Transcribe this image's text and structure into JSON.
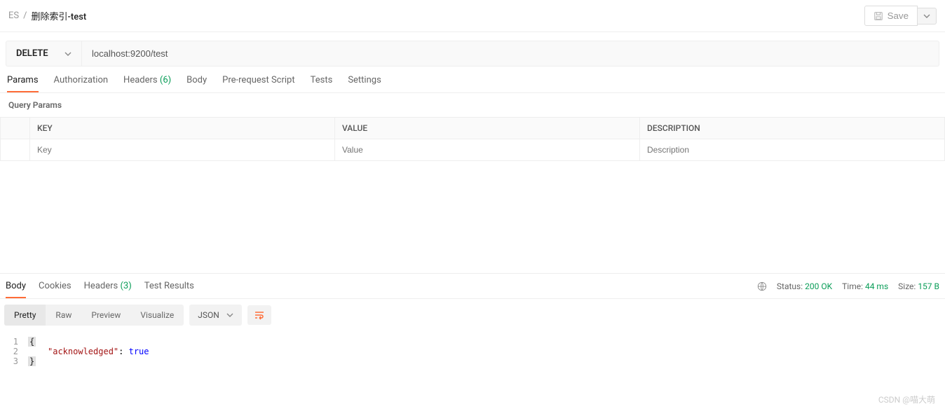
{
  "breadcrumb": {
    "workspace": "ES",
    "separator": "/",
    "title": "删除索引-test"
  },
  "header": {
    "save_label": "Save"
  },
  "request": {
    "method": "DELETE",
    "url": "localhost:9200/test"
  },
  "tabs": {
    "params": "Params",
    "authorization": "Authorization",
    "headers": "Headers",
    "headers_count": "(6)",
    "body": "Body",
    "prerequest": "Pre-request Script",
    "tests": "Tests",
    "settings": "Settings"
  },
  "section": {
    "query_params": "Query Params"
  },
  "table": {
    "headers": {
      "key": "KEY",
      "value": "VALUE",
      "description": "DESCRIPTION"
    },
    "placeholders": {
      "key": "Key",
      "value": "Value",
      "description": "Description"
    }
  },
  "response": {
    "tabs": {
      "body": "Body",
      "cookies": "Cookies",
      "headers": "Headers",
      "headers_count": "(3)",
      "test_results": "Test Results"
    },
    "meta": {
      "status_label": "Status:",
      "status_value": "200 OK",
      "time_label": "Time:",
      "time_value": "44 ms",
      "size_label": "Size:",
      "size_value": "157 B"
    },
    "views": {
      "pretty": "Pretty",
      "raw": "Raw",
      "preview": "Preview",
      "visualize": "Visualize"
    },
    "format": "JSON",
    "body_json": {
      "lines": [
        {
          "num": "1",
          "content_type": "open_brace"
        },
        {
          "num": "2",
          "content_type": "kv",
          "key": "\"acknowledged\"",
          "value": "true"
        },
        {
          "num": "3",
          "content_type": "close_brace"
        }
      ]
    }
  },
  "watermark": "CSDN @喵大萌"
}
